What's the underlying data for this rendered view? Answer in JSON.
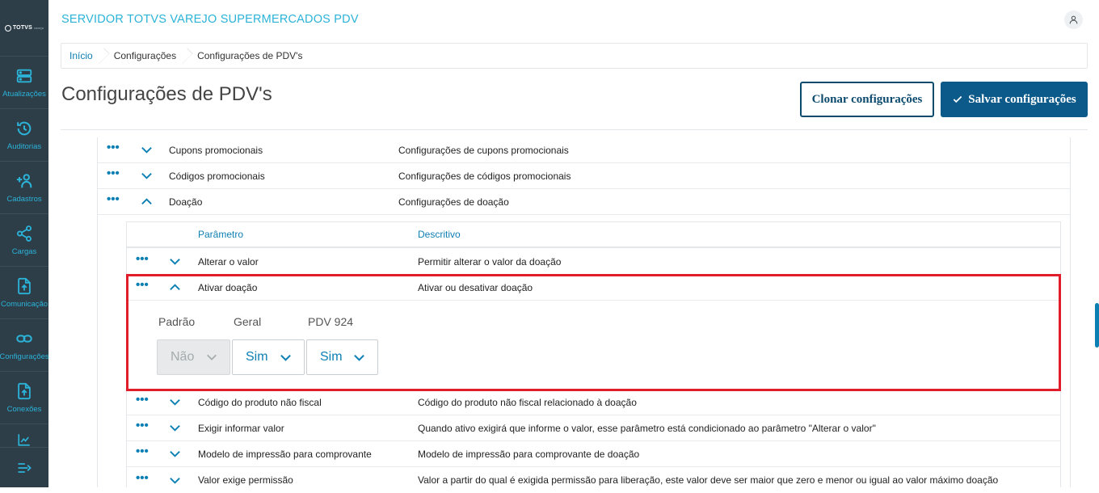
{
  "app": {
    "logo_text": "TOTVS",
    "logo_subtext": "varejo",
    "title": "SERVIDOR TOTVS VAREJO SUPERMERCADOS PDV"
  },
  "sidebar": {
    "items": [
      {
        "label": "Atualizações",
        "icon": "server-icon"
      },
      {
        "label": "Auditorias",
        "icon": "history-icon"
      },
      {
        "label": "Cadastros",
        "icon": "add-user-icon"
      },
      {
        "label": "Cargas",
        "icon": "share-icon"
      },
      {
        "label": "Comunicação",
        "icon": "upload-file-icon"
      },
      {
        "label": "Configurações",
        "icon": "link-icon"
      },
      {
        "label": "Conexões",
        "icon": "upload-file-icon"
      }
    ]
  },
  "breadcrumb": [
    "Início",
    "Configurações",
    "Configurações de PDV's"
  ],
  "page": {
    "title": "Configurações de PDV's",
    "clone_label": "Clonar configurações",
    "save_label": "Salvar configurações"
  },
  "groups": [
    {
      "name": "Cupons promocionais",
      "description": "Configurações de cupons promocionais",
      "expanded": false
    },
    {
      "name": "Códigos promocionais",
      "description": "Configurações de códigos promocionais",
      "expanded": false
    },
    {
      "name": "Doação",
      "description": "Configurações de doação",
      "expanded": true
    }
  ],
  "table": {
    "col_param": "Parâmetro",
    "col_desc": "Descritivo"
  },
  "params": [
    {
      "name": "Alterar o valor",
      "description": "Permitir alterar o valor da doação",
      "expanded": false
    },
    {
      "name": "Ativar doação",
      "description": "Ativar ou desativar doação",
      "expanded": true
    },
    {
      "name": "Código do produto não fiscal",
      "description": "Código do produto não fiscal relacionado à doação",
      "expanded": false
    },
    {
      "name": "Exigir informar valor",
      "description": "Quando ativo exigirá que informe o valor, esse parâmetro está condicionado ao parâmetro \"Alterar o valor\"",
      "expanded": false
    },
    {
      "name": "Modelo de impressão para comprovante",
      "description": "Modelo de impressão para comprovante de doação",
      "expanded": false
    },
    {
      "name": "Valor exige permissão",
      "description": "Valor a partir do qual é exigida permissão para liberação, este valor deve ser maior que zero e menor ou igual ao valor máximo doação",
      "expanded": false
    }
  ],
  "detail": {
    "labels": [
      "Padrão",
      "Geral",
      "PDV 924"
    ],
    "values": [
      "Não",
      "Sim",
      "Sim"
    ]
  },
  "colors": {
    "sidebar_bg": "#2d3e49",
    "accent": "#2bb3d8",
    "link": "#0c7fb3",
    "primary": "#0c5a8a",
    "highlight": "#e21d2b"
  }
}
